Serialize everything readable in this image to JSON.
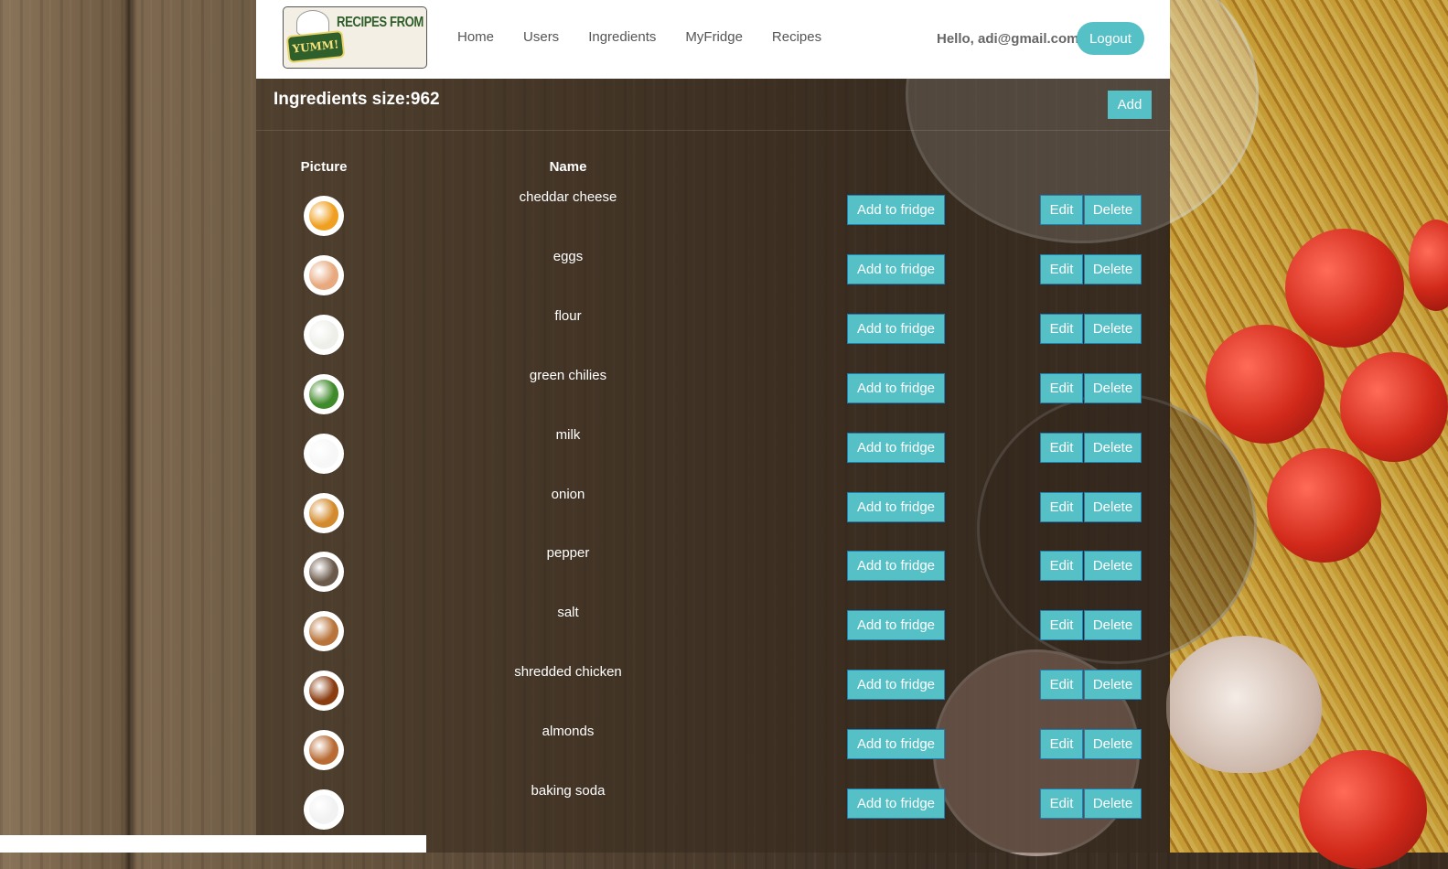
{
  "header": {
    "brand_text": "RECIPES FROM YOUR FRIDGE",
    "badge_text": "YUMM!",
    "nav": [
      "Home",
      "Users",
      "Ingredients",
      "MyFridge",
      "Recipes"
    ],
    "greeting": "Hello, adi@gmail.com!",
    "logout_label": "Logout"
  },
  "panel": {
    "title": "Ingredients size:962",
    "add_label": "Add",
    "columns": {
      "picture": "Picture",
      "name": "Name"
    },
    "action_labels": {
      "add_to_fridge": "Add to fridge",
      "edit": "Edit",
      "delete": "Delete"
    },
    "rows": [
      {
        "name": "cheddar cheese",
        "icon": "cheese-icon",
        "color": "#f0a020"
      },
      {
        "name": "eggs",
        "icon": "egg-icon",
        "color": "#e8a97e"
      },
      {
        "name": "flour",
        "icon": "flour-icon",
        "color": "#efefea"
      },
      {
        "name": "green chilies",
        "icon": "chili-icon",
        "color": "#3f8a2a"
      },
      {
        "name": "milk",
        "icon": "milk-icon",
        "color": "#f7f7f7"
      },
      {
        "name": "onion",
        "icon": "onion-icon",
        "color": "#d38a2c"
      },
      {
        "name": "pepper",
        "icon": "pepper-grinder-icon",
        "color": "#6b5a4a"
      },
      {
        "name": "salt",
        "icon": "salt-shaker-icon",
        "color": "#b8743a"
      },
      {
        "name": "shredded chicken",
        "icon": "chicken-icon",
        "color": "#8b3d12"
      },
      {
        "name": "almonds",
        "icon": "almond-icon",
        "color": "#b96b35"
      },
      {
        "name": "baking soda",
        "icon": "baking-soda-icon",
        "color": "#f2f2f2"
      }
    ]
  },
  "colors": {
    "accent": "#55c1c6",
    "button_border": "#1e7fb6"
  }
}
